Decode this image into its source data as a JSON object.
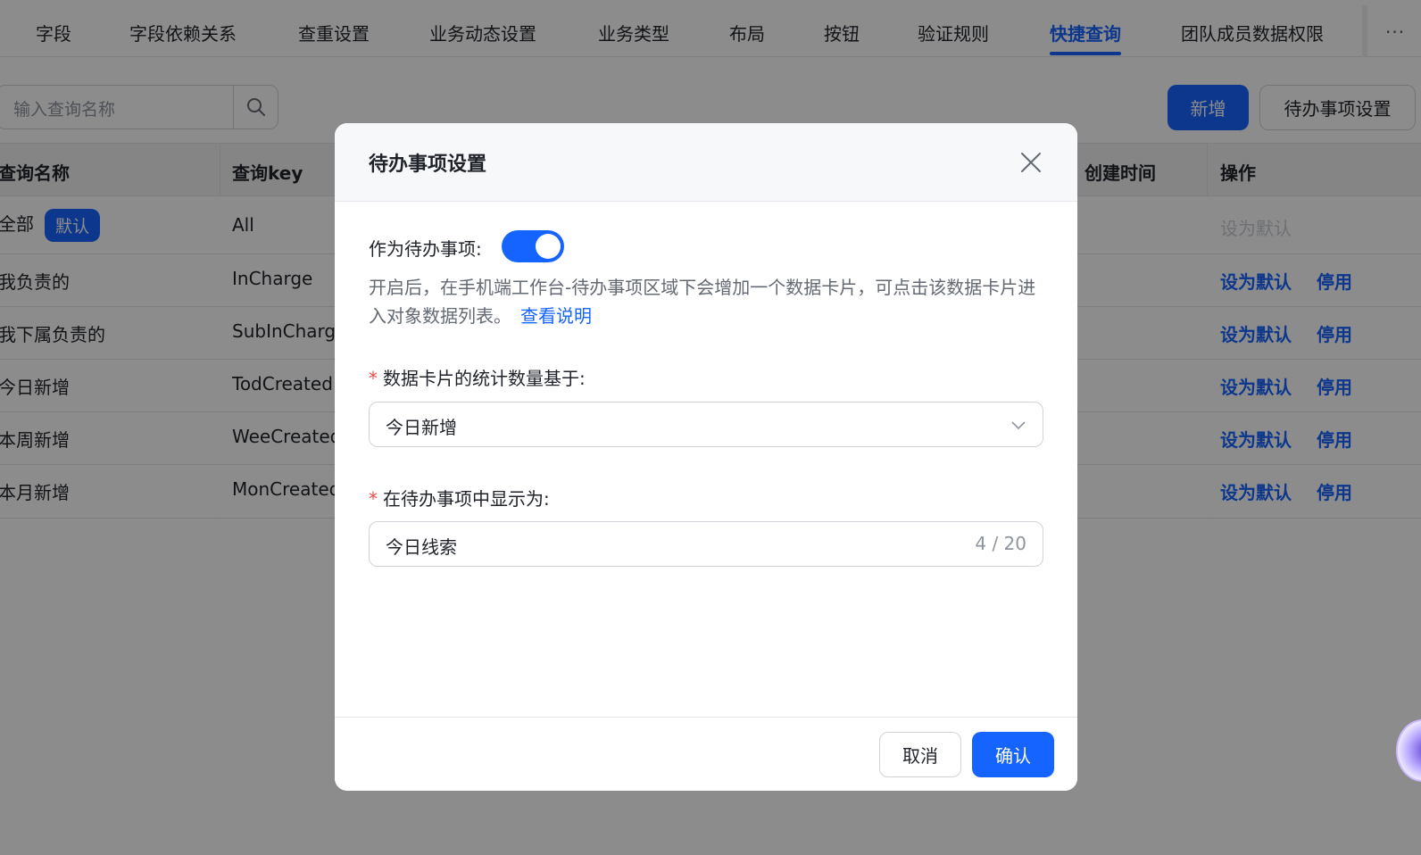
{
  "tabs": [
    {
      "label": "字段"
    },
    {
      "label": "字段依赖关系"
    },
    {
      "label": "查重设置"
    },
    {
      "label": "业务动态设置"
    },
    {
      "label": "业务类型"
    },
    {
      "label": "布局"
    },
    {
      "label": "按钮"
    },
    {
      "label": "验证规则"
    },
    {
      "label": "快捷查询",
      "active": true
    },
    {
      "label": "团队成员数据权限"
    }
  ],
  "more_label": "···",
  "toolbar": {
    "search_placeholder": "输入查询名称",
    "new_label": "新增",
    "todo_settings_label": "待办事项设置"
  },
  "table": {
    "headers": {
      "name": "查询名称",
      "key": "查询key",
      "created": "创建时间",
      "ops": "操作"
    },
    "rows": [
      {
        "name": "全部",
        "badge": "默认",
        "key": "All",
        "ops": [
          "设为默认"
        ],
        "ops_disabled": true
      },
      {
        "name": "我负责的",
        "key": "InCharge",
        "ops": [
          "设为默认",
          "停用"
        ]
      },
      {
        "name": "我下属负责的",
        "key": "SubInCharge",
        "ops": [
          "设为默认",
          "停用"
        ]
      },
      {
        "name": "今日新增",
        "key": "TodCreated",
        "ops": [
          "设为默认",
          "停用"
        ]
      },
      {
        "name": "本周新增",
        "key": "WeeCreated",
        "ops": [
          "设为默认",
          "停用"
        ]
      },
      {
        "name": "本月新增",
        "key": "MonCreated",
        "ops": [
          "设为默认",
          "停用"
        ]
      }
    ]
  },
  "modal": {
    "title": "待办事项设置",
    "toggle_label": "作为待办事项:",
    "toggle_on": true,
    "help_text": "开启后，在手机端工作台-待办事项区域下会增加一个数据卡片，可点击该数据卡片进入对象数据列表。",
    "help_link": "查看说明",
    "field1_label": "数据卡片的统计数量基于:",
    "field1_value": "今日新增",
    "field2_label": "在待办事项中显示为:",
    "field2_value": "今日线索",
    "field2_counter": "4 / 20",
    "cancel_label": "取消",
    "ok_label": "确认"
  },
  "colors": {
    "accent": "#1664ff",
    "required": "#f54a45",
    "mask": "rgba(0,0,0,0.45)"
  }
}
